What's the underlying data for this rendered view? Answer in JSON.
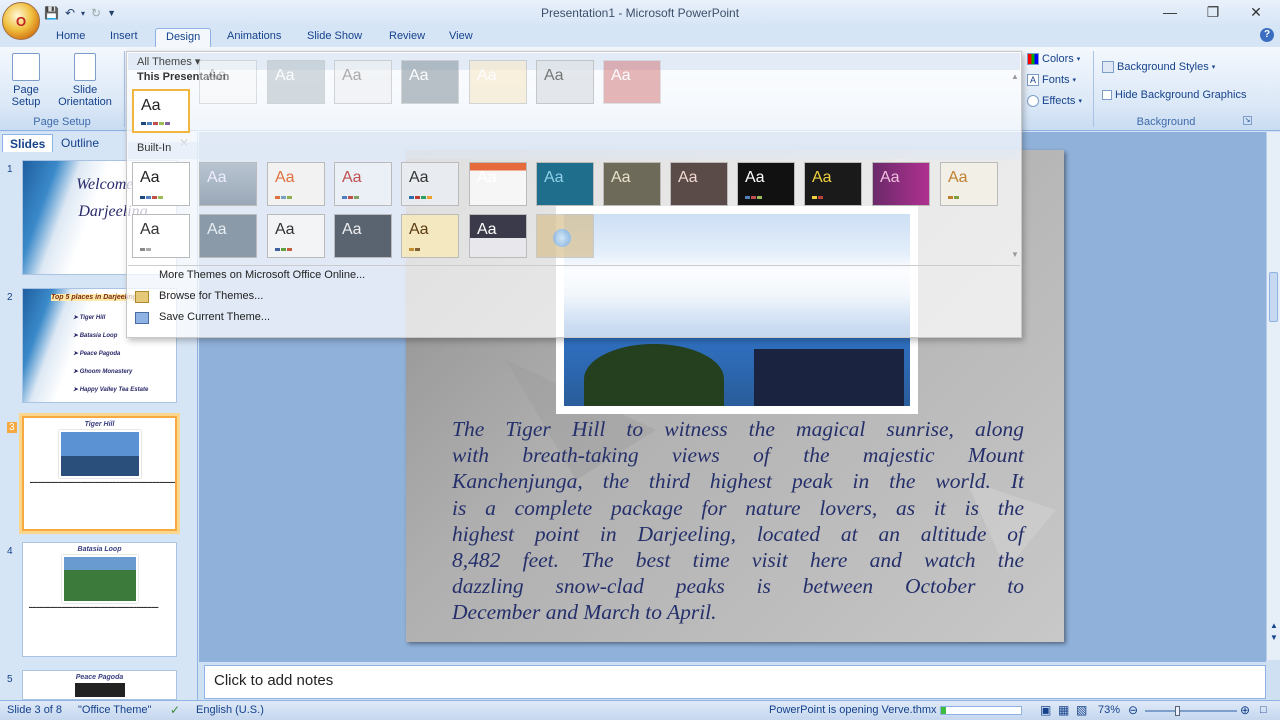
{
  "window": {
    "title": "Presentation1 - Microsoft PowerPoint",
    "office_button": "O"
  },
  "qat": {
    "items": [
      "save-icon",
      "undo-icon",
      "undo-dropdown-icon",
      "redo-icon",
      "customize-qat-icon"
    ]
  },
  "tabs": [
    {
      "label": "Home"
    },
    {
      "label": "Insert"
    },
    {
      "label": "Design"
    },
    {
      "label": "Animations"
    },
    {
      "label": "Slide Show"
    },
    {
      "label": "Review"
    },
    {
      "label": "View"
    }
  ],
  "ribbon": {
    "page_setup": {
      "btn1": "Page Setup",
      "btn2a": "Slide",
      "btn2b": "Orientation",
      "group": "Page Setup"
    },
    "themes": {
      "colors": "Colors",
      "fonts": "Fonts",
      "effects": "Effects"
    },
    "background": {
      "styles": "Background Styles",
      "hide": "Hide Background Graphics",
      "group": "Background"
    }
  },
  "left_pane": {
    "tabs": {
      "slides": "Slides",
      "outline": "Outline"
    },
    "thumbs": [
      {
        "num": "1",
        "title": "Welcome to Darjeeling"
      },
      {
        "num": "2",
        "title": "Top 5 places in Darjeeling",
        "items": [
          "Tiger Hill",
          "Batasia Loop",
          "Peace Pagoda",
          "Ghoom Monastery",
          "Happy Valley Tea Estate"
        ]
      },
      {
        "num": "3",
        "title": "Tiger Hill"
      },
      {
        "num": "4",
        "title": "Batasia Loop"
      },
      {
        "num": "5",
        "title": "Peace Pagoda"
      }
    ]
  },
  "slide": {
    "body_lines": [
      "The Tiger Hill to witness the magical sunrise, along",
      "with breath-taking views of the majestic Mount",
      "Kanchenjunga, the third highest peak in the world. It",
      "is a complete package for nature lovers, as it is the",
      "highest point in Darjeeling, located at an altitude of",
      "8,482 feet. The best time visit here and watch the",
      "dazzling snow-clad peaks is between October to",
      "December and March to April."
    ]
  },
  "notes": {
    "placeholder": "Click to add notes"
  },
  "gallery": {
    "filter": "All Themes",
    "section1": "This Presentation",
    "section2": "Built-In",
    "aa": "Aa",
    "links": [
      "More Themes on Microsoft Office Online...",
      "Browse for Themes...",
      "Save Current Theme..."
    ]
  },
  "status": {
    "slide": "Slide 3 of 8",
    "theme": "\"Office Theme\"",
    "lang": "English (U.S.)",
    "progress": "PowerPoint is opening Verve.thmx",
    "zoom": "73%"
  }
}
